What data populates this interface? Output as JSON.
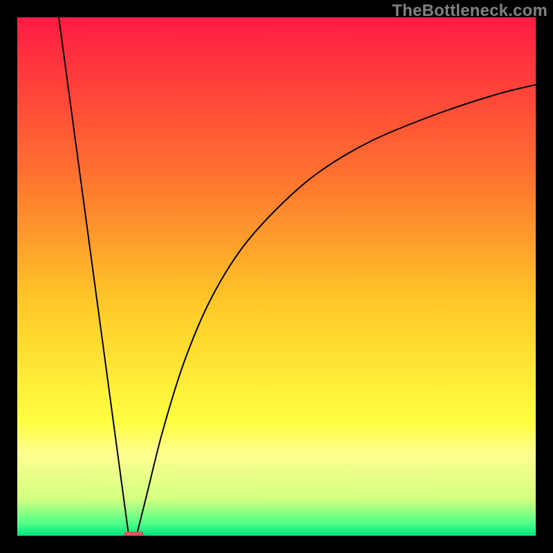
{
  "watermark": "TheBottleneck.com",
  "chart_data": {
    "type": "line",
    "title": "",
    "xlabel": "",
    "ylabel": "",
    "xlim": [
      0,
      100
    ],
    "ylim": [
      0,
      100
    ],
    "grid": false,
    "legend": false,
    "background_gradient": {
      "direction": "vertical",
      "stops": [
        {
          "pos": 0.0,
          "color": "#ff1b43"
        },
        {
          "pos": 0.33,
          "color": "#ff7a2e"
        },
        {
          "pos": 0.55,
          "color": "#ffc828"
        },
        {
          "pos": 0.78,
          "color": "#ffff40"
        },
        {
          "pos": 0.84,
          "color": "#ffff90"
        },
        {
          "pos": 0.93,
          "color": "#d2ff80"
        },
        {
          "pos": 0.975,
          "color": "#54ff8a"
        },
        {
          "pos": 1.0,
          "color": "#00e67a"
        }
      ]
    },
    "series": [
      {
        "name": "left-branch",
        "kind": "line",
        "x": [
          8.0,
          21.5
        ],
        "y": [
          100.0,
          0.0
        ]
      },
      {
        "name": "right-branch",
        "kind": "line",
        "x": [
          23,
          25,
          28,
          32,
          37,
          43,
          50,
          58,
          68,
          80,
          92,
          100
        ],
        "y": [
          0,
          8,
          20,
          33,
          45,
          55,
          63,
          70,
          76,
          81,
          85,
          87
        ]
      }
    ],
    "annotations": [
      {
        "name": "optimal-marker",
        "shape": "rounded-rect",
        "x_range": [
          20.5,
          24.5
        ],
        "y": 0,
        "color": "#d65a5a"
      }
    ]
  }
}
